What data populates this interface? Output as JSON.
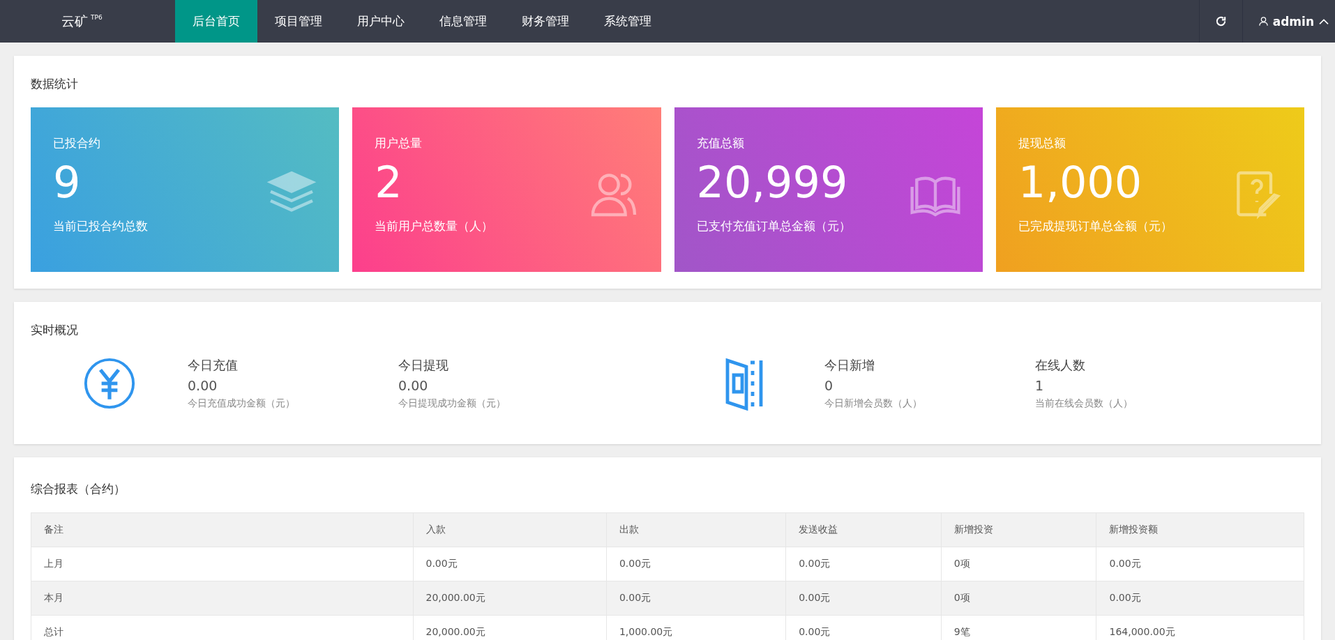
{
  "topbar": {
    "logo": "云矿",
    "logo_badge": "TP6",
    "nav": [
      {
        "label": "后台首页",
        "selected": true
      },
      {
        "label": "项目管理",
        "selected": false
      },
      {
        "label": "用户中心",
        "selected": false
      },
      {
        "label": "信息管理",
        "selected": false
      },
      {
        "label": "财务管理",
        "selected": false
      },
      {
        "label": "系统管理",
        "selected": false
      }
    ],
    "user": "admin"
  },
  "stats": {
    "title": "数据统计",
    "cards": [
      {
        "label": "已投合约",
        "value": "9",
        "note": "当前已投合约总数",
        "kind": "layers",
        "color": "#3aa0e0"
      },
      {
        "label": "用户总量",
        "value": "2",
        "note": "当前用户总数量（人）",
        "kind": "users",
        "color": "#fc3f8c"
      },
      {
        "label": "充值总额",
        "value": "20,999",
        "note": "已支付充值订单总金额（元）",
        "kind": "book",
        "color": "#a156c8"
      },
      {
        "label": "提现总额",
        "value": "1,000",
        "note": "已完成提现订单总金额（元）",
        "kind": "note",
        "color": "#f0a020"
      }
    ]
  },
  "realtime": {
    "title": "实时概况",
    "groups": [
      {
        "kind": "yen",
        "items": [
          {
            "label": "今日充值",
            "value": "0.00",
            "note": "今日充值成功金额（元）"
          },
          {
            "label": "今日提现",
            "value": "0.00",
            "note": "今日提现成功金额（元）"
          }
        ]
      },
      {
        "kind": "door",
        "items": [
          {
            "label": "今日新增",
            "value": "0",
            "note": "今日新增会员数（人）"
          },
          {
            "label": "在线人数",
            "value": "1",
            "note": "当前在线会员数（人）"
          }
        ]
      }
    ]
  },
  "report": {
    "title": "综合报表（合约）",
    "columns": [
      "备注",
      "入款",
      "出款",
      "发送收益",
      "新增投资",
      "新增投资额"
    ],
    "rows": [
      [
        "上月",
        "0.00元",
        "0.00元",
        "0.00元",
        "0项",
        "0.00元"
      ],
      [
        "本月",
        "20,000.00元",
        "0.00元",
        "0.00元",
        "0项",
        "0.00元"
      ],
      [
        "总计",
        "20,000.00元",
        "1,000.00元",
        "0.00元",
        "9笔",
        "164,000.00元"
      ]
    ]
  }
}
